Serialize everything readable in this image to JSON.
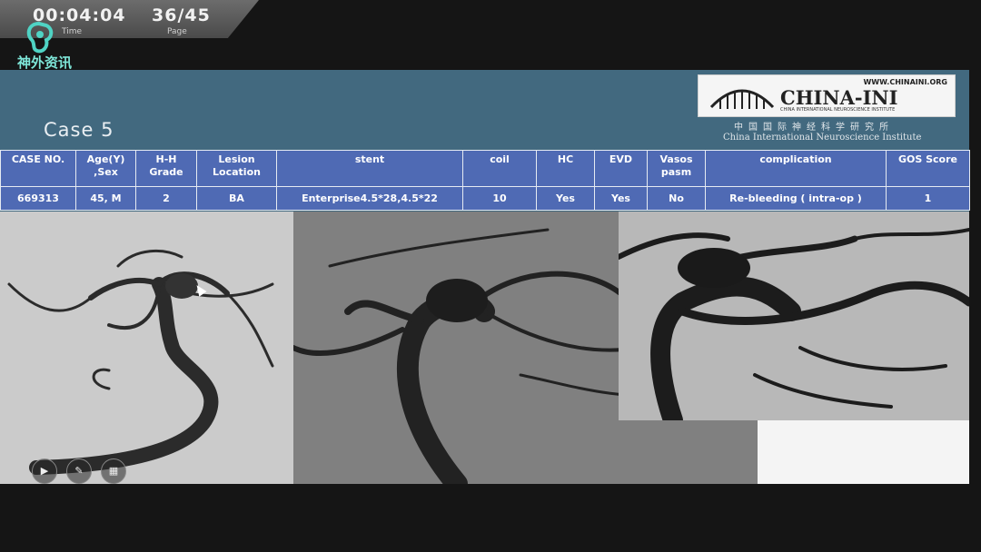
{
  "player": {
    "time_value": "00:04:04",
    "time_label": "Time",
    "page_value": "36/45",
    "page_label": "Page"
  },
  "brand": {
    "name": "神外资讯",
    "icon": "neuro-brain-logo-icon"
  },
  "slide": {
    "title": "Case 5",
    "logo": {
      "url": "WWW.CHINAINI.ORG",
      "name": "CHINA-INI",
      "small": "CHINA INTERNATIONAL NEUROSCIENCE INSTITUTE",
      "cn": "中国国际神经科学研究所",
      "en": "China International Neuroscience Institute"
    },
    "table": {
      "headers": [
        "CASE NO.",
        "Age(Y) ,Sex",
        "H-H Grade",
        "Lesion Location",
        "stent",
        "coil",
        "HC",
        "EVD",
        "Vasos pasm",
        "complication",
        "GOS Score"
      ],
      "rows": [
        [
          "669313",
          "45, M",
          "2",
          "BA",
          "Enterprise4.5*28,4.5*22",
          "10",
          "Yes",
          "Yes",
          "No",
          "Re-bleeding ( intra-op )",
          "1"
        ]
      ]
    }
  },
  "controls": [
    "play-icon",
    "edit-pen-icon",
    "grid-icon"
  ],
  "colors": {
    "slide_bg": "#42697f",
    "table_bg": "#4f6ab4"
  }
}
